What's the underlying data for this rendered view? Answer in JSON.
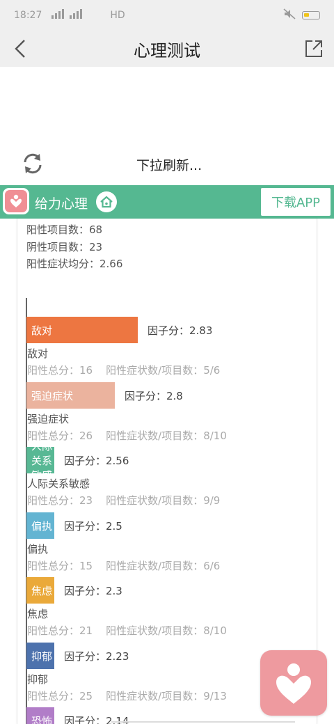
{
  "status": {
    "time": "18:27",
    "signal": "HD",
    "battery": "30"
  },
  "header": {
    "title": "心理测试"
  },
  "refresh": {
    "text": "下拉刷新..."
  },
  "appbar": {
    "name": "给力心理",
    "download_label": "下载APP"
  },
  "summary": {
    "positive_items": "阳性项目数：68",
    "negative_items": "阴性项目数：23",
    "positive_avg": "阳性症状均分：2.66"
  },
  "colors": {
    "brand_green": "#55b891",
    "logo_pink": "#ee9a9f"
  },
  "chart_data": {
    "type": "bar",
    "orientation": "horizontal",
    "categories": [
      "敌对",
      "强迫症状",
      "人际关系敏感",
      "偏执",
      "焦虑",
      "抑郁",
      "恐怖"
    ],
    "values": [
      2.83,
      2.8,
      2.56,
      2.5,
      2.3,
      2.23,
      2.14
    ],
    "colors": [
      "#ed7641",
      "#ebb39e",
      "#58b894",
      "#63b4d2",
      "#eaa93a",
      "#4d72ad",
      "#b17dc8"
    ],
    "score_labels": [
      "因子分：2.83",
      "因子分：2.8",
      "因子分：2.56",
      "因子分：2.5",
      "因子分：2.3",
      "因子分：2.23",
      "因子分：2.14"
    ],
    "factor_names": [
      "敌对",
      "强迫症状",
      "人际关系敏感",
      "偏执",
      "焦虑",
      "抑郁"
    ],
    "details": [
      "阳性总分：16    阳性症状数/项目数：5/6",
      "阳性总分：26    阳性症状数/项目数：8/10",
      "阳性总分：23    阳性症状数/项目数：9/9",
      "阳性总分：15    阳性症状数/项目数：6/6",
      "阳性总分：21    阳性症状数/项目数：8/10",
      "阳性总分：25    阳性症状数/项目数：9/13"
    ]
  }
}
